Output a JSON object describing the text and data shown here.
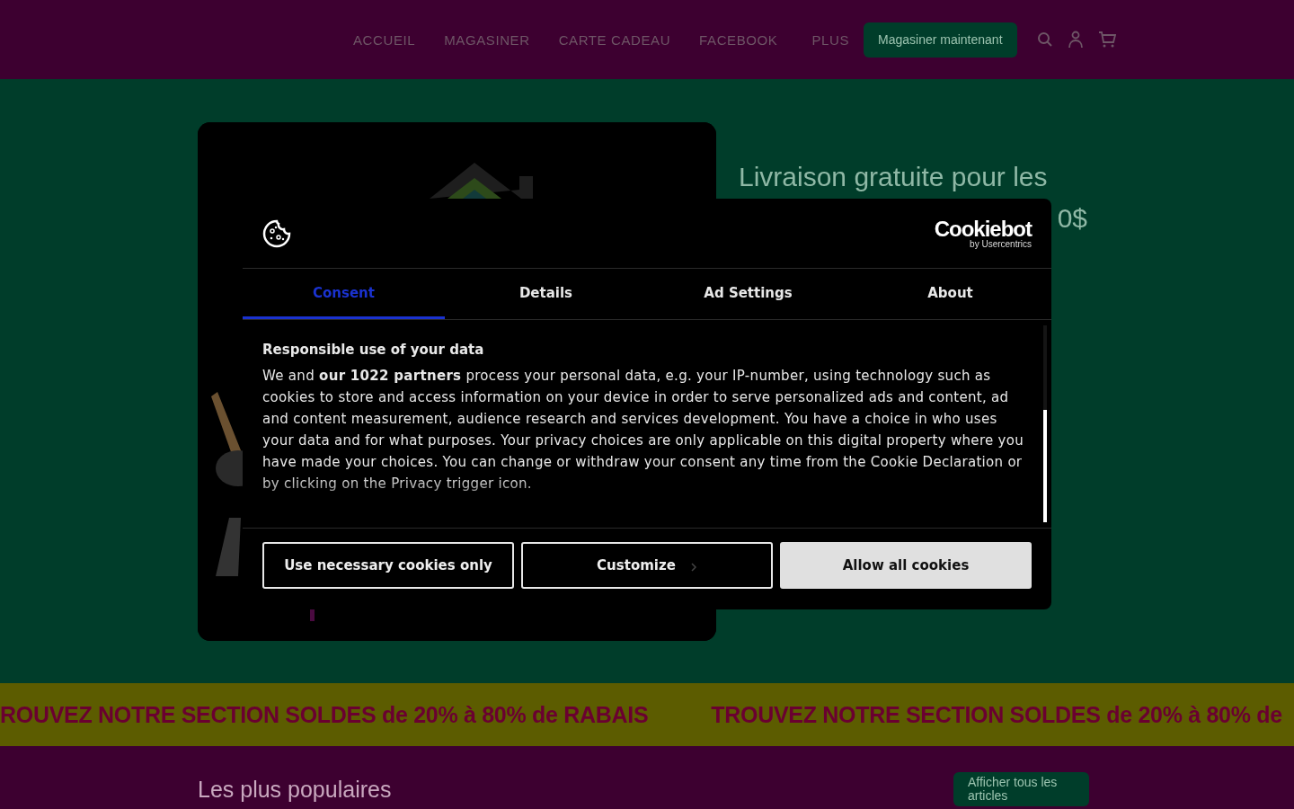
{
  "nav": {
    "links": [
      "ACCUEIL",
      "MAGASINER",
      "CARTE CADEAU",
      "FACEBOOK",
      "PLUS"
    ],
    "cta": "Magasiner maintenant"
  },
  "hero": {
    "heading_line_1": "Livraison gratuite pour les",
    "heading_line_2": "0$"
  },
  "cookie_dialog": {
    "brand": "Cookiebot",
    "brand_sub": "by Usercentrics",
    "tabs": [
      {
        "label": "Consent",
        "selected": true
      },
      {
        "label": "Details",
        "selected": false
      },
      {
        "label": "Ad Settings",
        "selected": false
      },
      {
        "label": "About",
        "selected": false
      }
    ],
    "title": "Responsible use of your data",
    "body": "We and **our 1022 partners** process your personal data, e.g. your IP-number, using technology such as cookies to store and access information on your device in order to serve personalized ads and content, ad and content measurement, audience research and services development. You have a choice in who uses your data and for what purposes. Your privacy choices are only applicable on this digital property where you have made your choices. You can change or withdraw your consent any time from the Cookie Declaration or by clicking on the Privacy trigger icon.",
    "buttons": [
      {
        "label": "Use necessary cookies only",
        "kind": "outline"
      },
      {
        "label": "Customize",
        "kind": "chevron"
      },
      {
        "label": "Allow all cookies",
        "kind": "filled"
      }
    ]
  },
  "marquee": [
    "ROUVEZ NOTRE SECTION SOLDES de 20% à 80% de RABAIS",
    "TROUVEZ NOTRE SECTION SOLDES de 20% à 80% de"
  ],
  "popular": {
    "title": "Les plus populaires",
    "button": "Afficher tous les articles"
  }
}
